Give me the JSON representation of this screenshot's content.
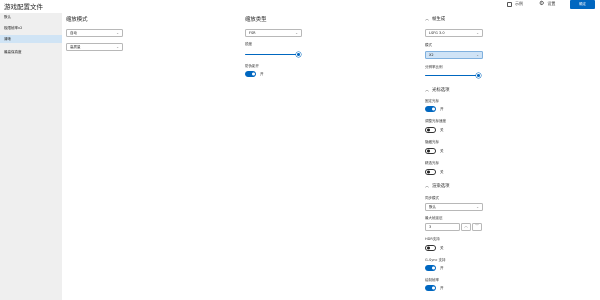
{
  "titlebar": {
    "title": "游戏配置文件",
    "checkbox_label": "示例",
    "settings_label": "设置",
    "confirm_label": "确定"
  },
  "sidebar": {
    "items": [
      {
        "label": "默认"
      },
      {
        "label": "极限帧率v2"
      },
      {
        "label": "清晰"
      },
      {
        "label": "最高保真度"
      }
    ],
    "active_index": 2
  },
  "scaling": {
    "title": "缩放模式",
    "mode": "自动",
    "quality": "高质量"
  },
  "upscaler": {
    "title": "缩放类型",
    "type": "FSR",
    "sharpness_label": "锐度",
    "sharpness_value": 1.0,
    "hdr_label": "防伪影开",
    "hdr_state": "开",
    "hdr_on": true
  },
  "framegen": {
    "title": "帧生成",
    "version": "LSFG 3.0",
    "mode_label": "模式",
    "mode_value": "X2",
    "flow_label": "分辨率比例",
    "flow_value": 1.0
  },
  "cursor": {
    "title": "光标选项",
    "items": [
      {
        "label": "固定光标",
        "state": "开",
        "on": true
      },
      {
        "label": "调整光标速度",
        "state": "关",
        "on": false
      },
      {
        "label": "隐藏光标",
        "state": "关",
        "on": false
      },
      {
        "label": "精选光标",
        "state": "关",
        "on": false
      }
    ]
  },
  "render": {
    "title": "渲染选项",
    "sync_label": "同步模式",
    "sync_value": "默认",
    "max_latency_label": "最大帧延迟",
    "max_latency_value": "3",
    "spin_up": "︿",
    "spin_down": "﹀",
    "toggles": [
      {
        "label": "HDR支持",
        "state": "关",
        "on": false
      },
      {
        "label": "G-Sync 支持",
        "state": "开",
        "on": true
      },
      {
        "label": "绘制帧率",
        "state": "开",
        "on": true
      }
    ]
  },
  "colors": {
    "accent": "#0067c0",
    "sidebar_bg": "#efefef",
    "active_item_bg": "#d0e4f5"
  }
}
